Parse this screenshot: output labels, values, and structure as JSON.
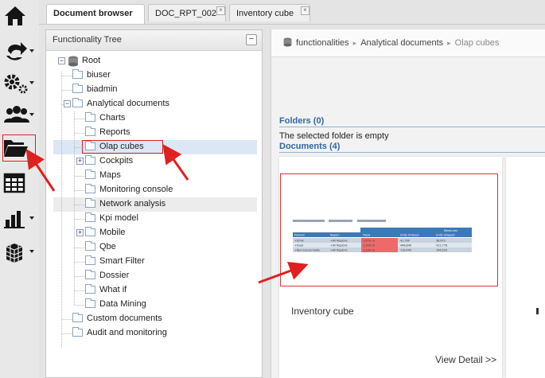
{
  "tabs": [
    {
      "label": "Document browser",
      "closable": false,
      "active": true
    },
    {
      "label": "DOC_RPT_002",
      "closable": true,
      "active": false
    },
    {
      "label": "Inventory cube",
      "closable": true,
      "active": false
    }
  ],
  "rail": {
    "icons": [
      "home-icon",
      "share-icon",
      "settings-icon",
      "users-icon",
      "folder-icon",
      "table-icon",
      "bar-chart-icon",
      "cube-icon"
    ],
    "active": "folder-icon"
  },
  "tree": {
    "title": "Functionality Tree",
    "collapse_symbol": "−",
    "root": "Root",
    "nodes": {
      "biuser": "biuser",
      "biadmin": "biadmin",
      "analytical": "Analytical documents",
      "charts": "Charts",
      "reports": "Reports",
      "olap": "Olap cubes",
      "cockpits": "Cockpits",
      "maps": "Maps",
      "monitoring": "Monitoring console",
      "network": "Network analysis",
      "kpi": "Kpi model",
      "mobile": "Mobile",
      "qbe": "Qbe",
      "smartfilter": "Smart Filter",
      "dossier": "Dossier",
      "whatif": "What if",
      "datamining": "Data Mining",
      "custom": "Custom documents",
      "audit": "Audit and monitoring"
    },
    "selected": "Olap cubes"
  },
  "breadcrumb": [
    "functionalities",
    "Analytical documents",
    "Olap cubes"
  ],
  "folders_header": "Folders (0)",
  "folders_empty": "The selected folder is empty",
  "documents_header": "Documents (4)",
  "document_card": {
    "title": "Inventory cube",
    "detail_link": "View Detail >>",
    "thumbnail": {
      "measures": "Measures",
      "headers": [
        "Product",
        "Region",
        "Trend",
        "Units Ordered",
        "Units Shipped"
      ],
      "rows": [
        [
          "+Drink",
          "+All Regions",
          "1.07% %",
          "41,760",
          "38,673"
        ],
        [
          "+Food",
          "+All Regions",
          "1.10% %",
          "448,840",
          "412,778"
        ],
        [
          "+Non-Consumable",
          "+All Regions",
          "1.23% %",
          "116,490",
          "106,533"
        ]
      ]
    }
  },
  "colors": {
    "accent": "#2f68a6",
    "highlight": "#e02020",
    "selected_row": "#dce7f5"
  }
}
